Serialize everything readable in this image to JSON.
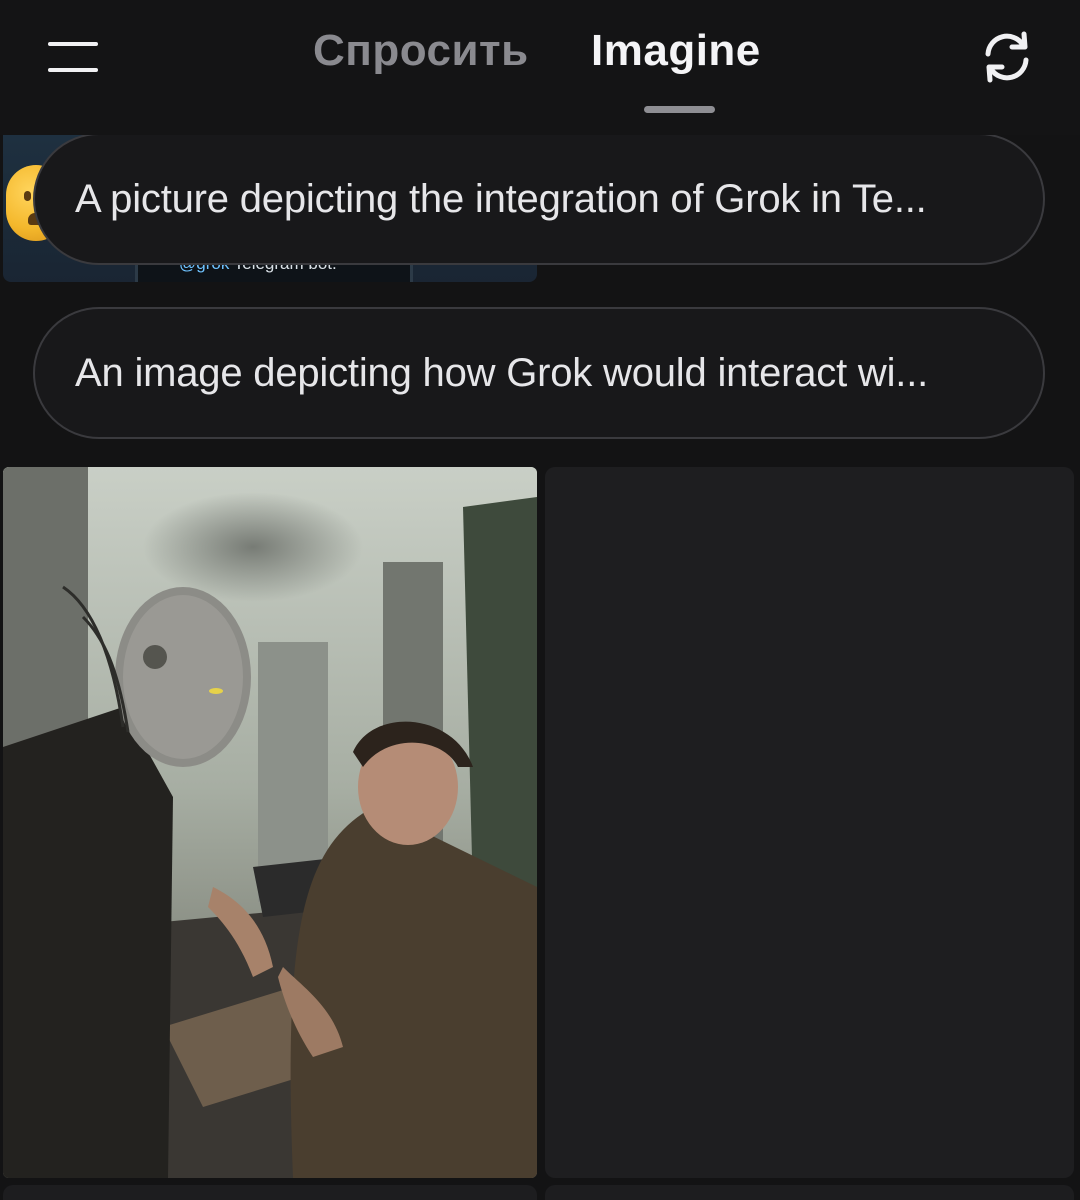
{
  "header": {
    "tabs": [
      {
        "label": "Спросить",
        "active": false
      },
      {
        "label": "Imagine",
        "active": true
      }
    ],
    "menu_icon": "hamburger-menu-icon",
    "refresh_icon": "refresh-icon"
  },
  "feed": {
    "thumbnail_top": {
      "caption_handle": "@grok",
      "caption_text": " Telegram bot."
    },
    "prompts": [
      {
        "text": "A picture depicting the integration of Grok in Te..."
      },
      {
        "text": "An image depicting how Grok would interact wi..."
      }
    ]
  },
  "colors": {
    "background": "#131314",
    "active_tab": "#f4f4f6",
    "inactive_tab": "#8a8a8f",
    "pill_border": "#3a3a3e"
  }
}
